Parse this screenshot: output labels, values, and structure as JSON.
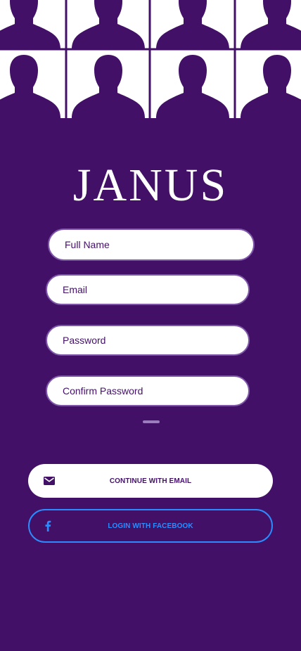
{
  "brand": {
    "logo": "JANUS"
  },
  "form": {
    "full_name_placeholder": "Full Name",
    "email_placeholder": "Email",
    "password_placeholder": "Password",
    "confirm_password_placeholder": "Confirm Password"
  },
  "actions": {
    "email_label": "CONTINUE WITH EMAIL",
    "email_icon": "envelope-icon",
    "facebook_label": "LOGIN WITH FACEBOOK",
    "facebook_icon": "facebook-icon"
  },
  "colors": {
    "background": "#421167",
    "accent_facebook": "#2b8cff",
    "field_border": "#7f57a8"
  }
}
